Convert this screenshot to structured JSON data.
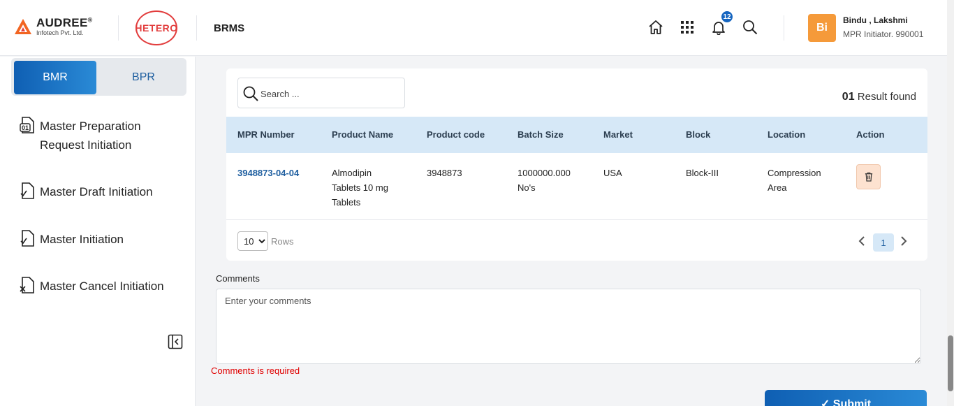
{
  "header": {
    "brand": "AUDREE",
    "brand_mark": "®",
    "brand_sub": "Infotech Pvt. Ltd.",
    "partner": "HETERO",
    "app_name": "BRMS",
    "notification_count": "12",
    "user_initials": "Bi",
    "user_name": "Bindu , Lakshmi",
    "user_role": "MPR Initiator. 990001"
  },
  "sidebar": {
    "tabs": {
      "active": "BMR",
      "inactive": "BPR"
    },
    "items": [
      {
        "label": "Master Preparation Request Initiation",
        "icon": "document-01-icon"
      },
      {
        "label": "Master Draft Initiation",
        "icon": "document-check-icon"
      },
      {
        "label": "Master Initiation",
        "icon": "document-check-icon"
      },
      {
        "label": "Master Cancel Initiation",
        "icon": "document-cancel-icon"
      }
    ]
  },
  "search": {
    "placeholder": "Search ..."
  },
  "results": {
    "count": "01",
    "label": "Result found"
  },
  "table": {
    "columns": [
      "MPR Number",
      "Product Name",
      "Product code",
      "Batch Size",
      "Market",
      "Block",
      "Location",
      "Action"
    ],
    "rows": [
      {
        "mpr_number": "3948873-04-04",
        "product_name_1": "Almodipin",
        "product_name_2": "Tablets 10 mg",
        "product_name_3": "Tablets",
        "product_code": "3948873",
        "batch_size_1": "1000000.000",
        "batch_size_2": "No's",
        "market": "USA",
        "block": "Block-III",
        "location_1": "Compression",
        "location_2": "Area"
      }
    ]
  },
  "pagination": {
    "rows_value": "10",
    "rows_label": "Rows",
    "page": "1"
  },
  "comments": {
    "label": "Comments",
    "placeholder": "Enter your comments",
    "error": "Comments is required"
  },
  "submit": {
    "label": "✓ Submit"
  },
  "colors": {
    "accent": "#1565c0",
    "avatar": "#f59a3a",
    "error": "#e00000",
    "table_header": "#d6e8f7",
    "brand_red": "#e23d3d"
  }
}
